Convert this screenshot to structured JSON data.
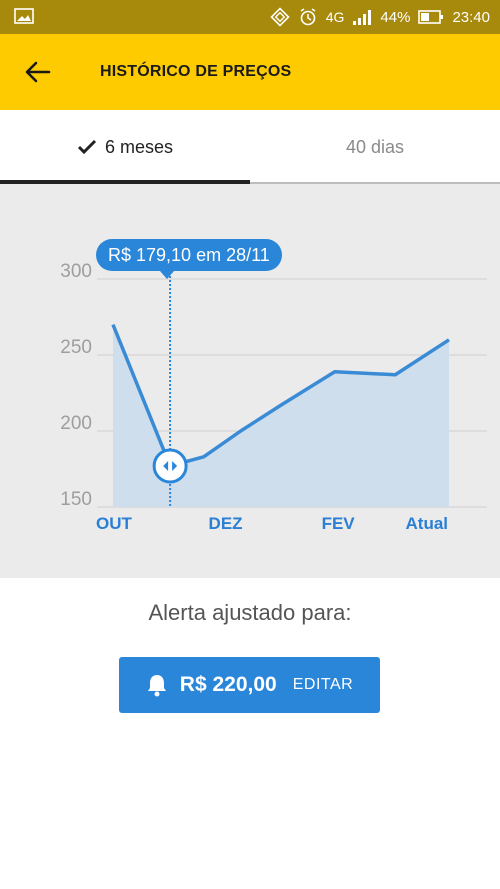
{
  "status_bar": {
    "network": "4G",
    "battery": "44%",
    "time": "23:40"
  },
  "app_bar": {
    "title": "HISTÓRICO DE PREÇOS"
  },
  "tabs": [
    {
      "label": "6 meses",
      "selected": true
    },
    {
      "label": "40 dias",
      "selected": false
    }
  ],
  "chart": {
    "tooltip": "R$ 179,10 em 28/11"
  },
  "chart_data": {
    "type": "area",
    "x_ticks": [
      "OUT",
      "DEZ",
      "FEV",
      "Atual"
    ],
    "y_ticks": [
      "300",
      "250",
      "200",
      "150"
    ],
    "ylim": [
      150,
      300
    ],
    "grid": true,
    "x": [
      0,
      0.17,
      0.27,
      0.38,
      0.5,
      0.66,
      0.84,
      1.0
    ],
    "values": [
      270,
      177,
      183,
      200,
      217,
      239,
      237,
      260
    ],
    "highlight": {
      "x": 0.17,
      "value": 179.1,
      "label": "R$ 179,10 em 28/11"
    },
    "colors": {
      "line": "#3a8bd6",
      "fill": "#cfdeec",
      "axis_labels_y": "#9e9e9e",
      "axis_labels_x": "#2a7fd4"
    }
  },
  "alert": {
    "label": "Alerta ajustado para:",
    "price": "R$ 220,00",
    "edit_label": "EDITAR"
  },
  "colors": {
    "status_bar": "#a7890b",
    "app_bar": "#fecb00",
    "primary": "#2a86d9",
    "chart_bg": "#ebebeb"
  }
}
